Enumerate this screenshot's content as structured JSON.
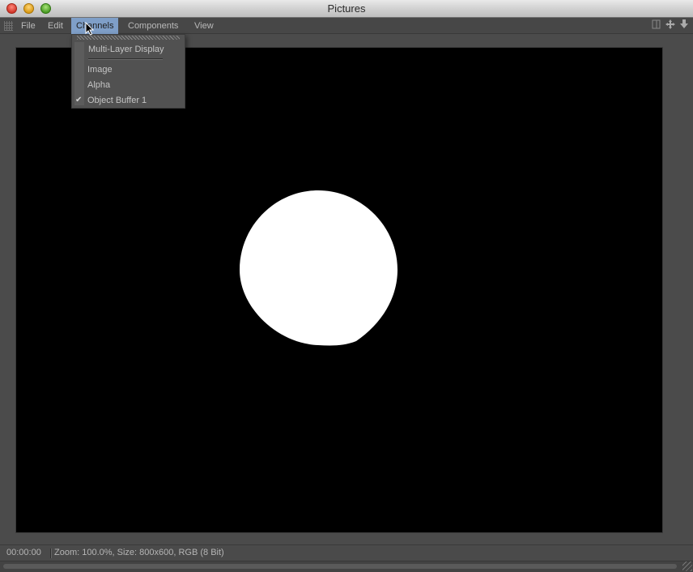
{
  "window": {
    "title": "Pictures"
  },
  "menubar": {
    "items": [
      {
        "label": "File"
      },
      {
        "label": "Edit"
      },
      {
        "label": "Channels",
        "active": true
      },
      {
        "label": "Components"
      },
      {
        "label": "View"
      }
    ],
    "right_icons": [
      "layout-icon",
      "move-icon",
      "download-icon"
    ]
  },
  "channels_menu": {
    "header": "Multi-Layer Display",
    "items": [
      {
        "label": "Image",
        "checked": false
      },
      {
        "label": "Alpha",
        "checked": false
      },
      {
        "label": "Object Buffer 1",
        "checked": true
      }
    ],
    "check_glyph": "✔"
  },
  "status": {
    "time": "00:00:00",
    "info": "Zoom: 100.0%, Size: 800x600, RGB (8 Bit)"
  },
  "colors": {
    "menu_highlight": "#7f9fc8",
    "image_background": "#000000",
    "shape_fill": "#ffffff"
  }
}
